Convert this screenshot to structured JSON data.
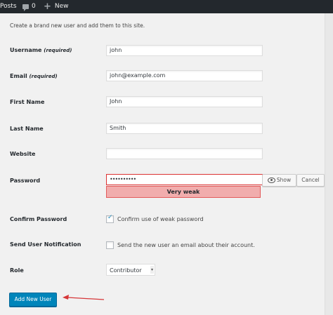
{
  "adminbar": {
    "posts_label": "Posts",
    "comments_count": "0",
    "new_label": "New"
  },
  "intro_text": "Create a brand new user and add them to this site.",
  "fields": {
    "username": {
      "label": "Username",
      "note": "(required)",
      "value": "john"
    },
    "email": {
      "label": "Email",
      "note": "(required)",
      "value": "john@example.com"
    },
    "first_name": {
      "label": "First Name",
      "value": "John"
    },
    "last_name": {
      "label": "Last Name",
      "value": "Smith"
    },
    "website": {
      "label": "Website",
      "value": ""
    },
    "password": {
      "label": "Password",
      "value": "••••••••••",
      "strength": "Very weak",
      "show_label": "Show",
      "cancel_label": "Cancel"
    },
    "confirm_password": {
      "label": "Confirm Password",
      "checkbox_label": "Confirm use of weak password",
      "checked": true
    },
    "send_notification": {
      "label": "Send User Notification",
      "checkbox_label": "Send the new user an email about their account.",
      "checked": false
    },
    "role": {
      "label": "Role",
      "selected": "Contributor"
    }
  },
  "submit_label": "Add New User",
  "colors": {
    "accent": "#0085ba",
    "arrow": "#d63638",
    "weak": "#f1adad"
  }
}
